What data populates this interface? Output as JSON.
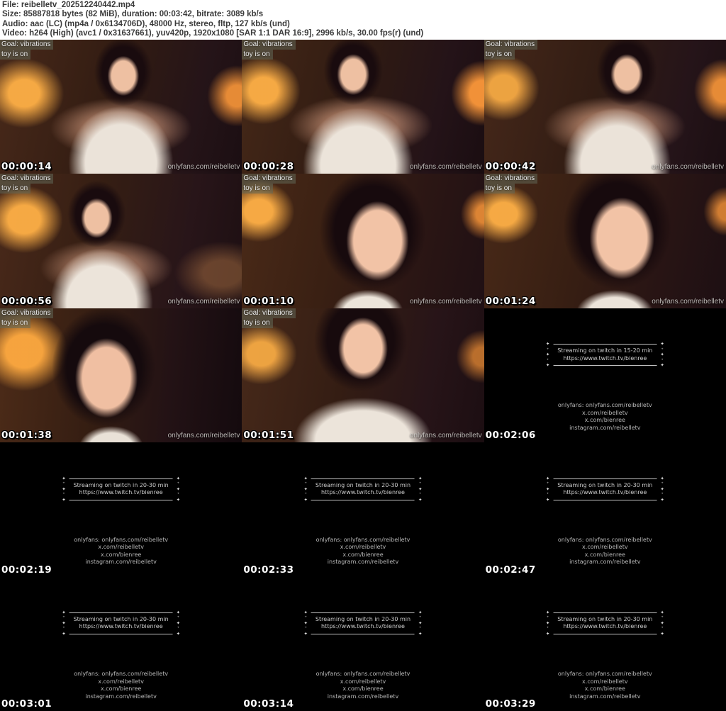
{
  "header": {
    "lines": [
      "File: reibelletv_202512240442.mp4",
      "Size: 85887818 bytes (82 MiB), duration: 00:03:42, bitrate: 3089 kb/s",
      "Audio: aac (LC) (mp4a / 0x6134706D), 48000 Hz, stereo, fltp, 127 kb/s (und)",
      "Video: h264 (High) (avc1 / 0x31637661), yuv420p, 1920x1080 [SAR 1:1 DAR 16:9], 2996 kb/s, 30.00 fps(r) (und)"
    ]
  },
  "overlay": {
    "goal_line1": "Goal: vibrations",
    "goal_line2": "toy is on",
    "watermark": "onlyfans.com/reibelletv"
  },
  "notice": {
    "twitch_url": "https://www.twitch.tv/bienree",
    "social_lines": [
      "onlyfans: onlyfans.com/reibelletv",
      "x.com/reibelletv",
      "x.com/bienree",
      "instagram.com/reibelletv"
    ]
  },
  "icons": {
    "sparkle": "✦",
    "sparkle_small": "⁺"
  },
  "colors": {
    "header_text": "#3b3b3b",
    "timestamp_text": "#ffffff",
    "notice_text": "#c8c8c8",
    "lamp_glow": "#ffb046"
  },
  "frames": [
    {
      "timestamp": "00:00:14",
      "kind": "photo",
      "variant": "v1"
    },
    {
      "timestamp": "00:00:28",
      "kind": "photo",
      "variant": "v2"
    },
    {
      "timestamp": "00:00:42",
      "kind": "photo",
      "variant": "v3"
    },
    {
      "timestamp": "00:00:56",
      "kind": "photo",
      "variant": "v4"
    },
    {
      "timestamp": "00:01:10",
      "kind": "photo",
      "variant": "v5"
    },
    {
      "timestamp": "00:01:24",
      "kind": "photo",
      "variant": "v6"
    },
    {
      "timestamp": "00:01:38",
      "kind": "photo",
      "variant": "v7"
    },
    {
      "timestamp": "00:01:51",
      "kind": "photo",
      "variant": "v8"
    },
    {
      "timestamp": "00:02:06",
      "kind": "notice",
      "notice_line": "Streaming on twitch in 15-20 min"
    },
    {
      "timestamp": "00:02:19",
      "kind": "notice",
      "notice_line": "Streaming on twitch in 20-30 min"
    },
    {
      "timestamp": "00:02:33",
      "kind": "notice",
      "notice_line": "Streaming on twitch in 20-30 min"
    },
    {
      "timestamp": "00:02:47",
      "kind": "notice",
      "notice_line": "Streaming on twitch in 20-30 min"
    },
    {
      "timestamp": "00:03:01",
      "kind": "notice",
      "notice_line": "Streaming on twitch in 20-30 min"
    },
    {
      "timestamp": "00:03:14",
      "kind": "notice",
      "notice_line": "Streaming on twitch in 20-30 min"
    },
    {
      "timestamp": "00:03:29",
      "kind": "notice",
      "notice_line": "Streaming on twitch in 20-30 min"
    }
  ]
}
